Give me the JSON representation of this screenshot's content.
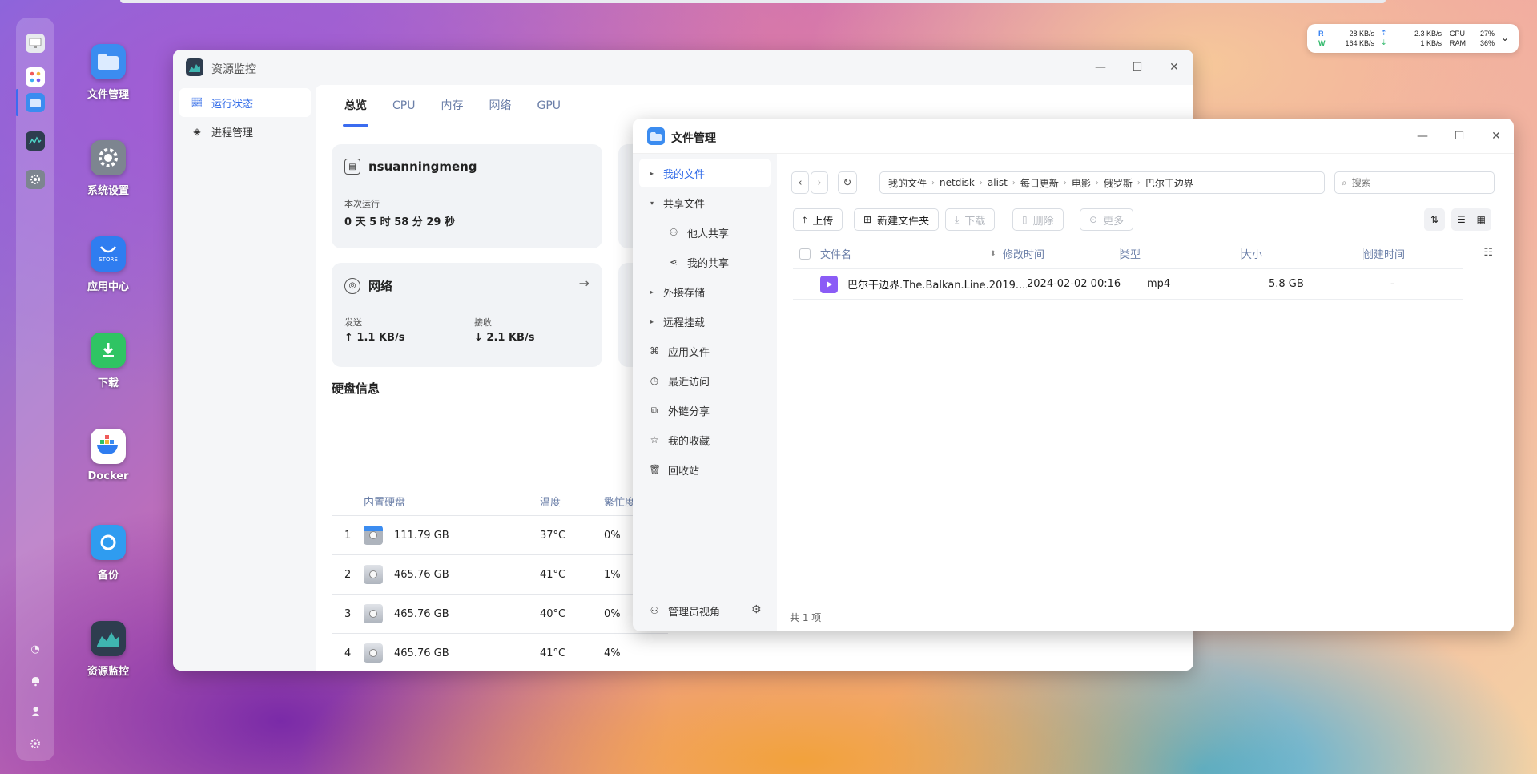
{
  "dock": {
    "items": [
      "monitor-icon",
      "apps-grid-icon",
      "file-manager-icon",
      "resource-monitor-icon",
      "settings-icon"
    ],
    "bottom": [
      "clock-icon",
      "bell-icon",
      "user-icon",
      "gear-icon"
    ]
  },
  "desktop": {
    "icons": [
      {
        "label": "文件管理",
        "color": "#3b8cf0"
      },
      {
        "label": "系统设置",
        "color": "#7d8590"
      },
      {
        "label": "应用中心",
        "color": "#2f7df0",
        "sub": "STORE"
      },
      {
        "label": "下载",
        "color": "#2fc463"
      },
      {
        "label": "Docker",
        "color": "#ffffff"
      },
      {
        "label": "备份",
        "color": "#2f9cf0"
      },
      {
        "label": "资源监控",
        "color": "#2e3d4f"
      }
    ]
  },
  "status": {
    "r_label": "R",
    "w_label": "W",
    "r_speed": "28 KB/s",
    "w_speed": "164 KB/s",
    "up_speed": "2.3 KB/s",
    "down_speed": "1 KB/s",
    "cpu_label": "CPU",
    "ram_label": "RAM",
    "cpu_value": "27%",
    "ram_value": "36%"
  },
  "resource_monitor": {
    "title": "资源监控",
    "nav": [
      {
        "label": "运行状态",
        "active": true
      },
      {
        "label": "进程管理",
        "active": false
      }
    ],
    "tabs": [
      "总览",
      "CPU",
      "内存",
      "网络",
      "GPU"
    ],
    "system_card": {
      "hostname": "nsuanningmeng",
      "uptime_label": "本次运行",
      "uptime_value": "0 天 5 时 58 分 29 秒"
    },
    "network_card": {
      "title": "网络",
      "send_label": "发送",
      "send_value": "↑ 1.1 KB/s",
      "recv_label": "接收",
      "recv_value": "↓ 2.1 KB/s"
    },
    "disk_section": {
      "title": "硬盘信息",
      "headers": [
        "内置硬盘",
        "温度",
        "繁忙度"
      ],
      "rows": [
        {
          "index": "1",
          "size": "111.79 GB",
          "temp": "37°C",
          "busy": "0%"
        },
        {
          "index": "2",
          "size": "465.76 GB",
          "temp": "41°C",
          "busy": "1%"
        },
        {
          "index": "3",
          "size": "465.76 GB",
          "temp": "40°C",
          "busy": "0%"
        },
        {
          "index": "4",
          "size": "465.76 GB",
          "temp": "41°C",
          "busy": "4%"
        }
      ]
    }
  },
  "file_manager": {
    "title": "文件管理",
    "nav": [
      {
        "label": "我的文件",
        "type": "expand",
        "active": true
      },
      {
        "label": "共享文件",
        "type": "expanded"
      },
      {
        "label": "他人共享",
        "type": "sub",
        "icon": "users-icon"
      },
      {
        "label": "我的共享",
        "type": "sub",
        "icon": "share-icon"
      },
      {
        "label": "外接存储",
        "type": "expand"
      },
      {
        "label": "远程挂载",
        "type": "expand"
      },
      {
        "label": "应用文件",
        "type": "icon",
        "icon": "apps-icon"
      },
      {
        "label": "最近访问",
        "type": "icon",
        "icon": "clock-icon"
      },
      {
        "label": "外链分享",
        "type": "icon",
        "icon": "external-link-icon"
      },
      {
        "label": "我的收藏",
        "type": "icon",
        "icon": "star-icon"
      },
      {
        "label": "回收站",
        "type": "icon",
        "icon": "trash-icon"
      }
    ],
    "footer_left": "管理员视角",
    "breadcrumb": [
      "我的文件",
      "netdisk",
      "alist",
      "每日更新",
      "电影",
      "俄罗斯",
      "巴尔干边界"
    ],
    "search_placeholder": "搜索",
    "toolbar": {
      "upload": "上传",
      "new_folder": "新建文件夹",
      "download": "下载",
      "delete": "删除",
      "more": "更多"
    },
    "columns": [
      "文件名",
      "修改时间",
      "类型",
      "大小",
      "创建时间"
    ],
    "files": [
      {
        "name": "巴尔干边界.The.Balkan.Line.2019....",
        "modified": "2024-02-02 00:16",
        "type": "mp4",
        "size": "5.8 GB",
        "created": "-"
      }
    ],
    "footer_count": "共 1 项"
  }
}
